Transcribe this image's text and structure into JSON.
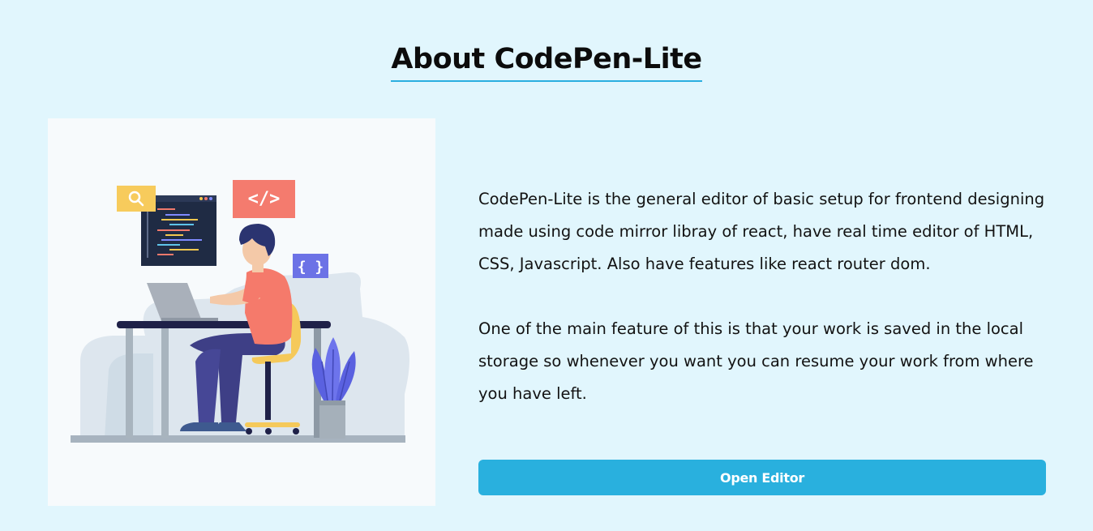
{
  "page": {
    "title": "About CodePen-Lite"
  },
  "illustration": {
    "icon_search": "search-icon",
    "icon_code": "</>",
    "icon_braces": "{ }"
  },
  "about": {
    "paragraph_1": "CodePen-Lite is the general editor of basic setup for frontend designing made using code mirror libray of react, have real time editor of HTML, CSS, Javascript. Also have features like react router dom.",
    "paragraph_2": "One of the main feature of this is that your work is saved in the local storage so whenever you want you can resume your work from where you have left."
  },
  "actions": {
    "open_editor_label": "Open Editor"
  },
  "colors": {
    "page_background": "#e1f6fd",
    "accent": "#29b0de",
    "card_background": "#f7fafc"
  }
}
